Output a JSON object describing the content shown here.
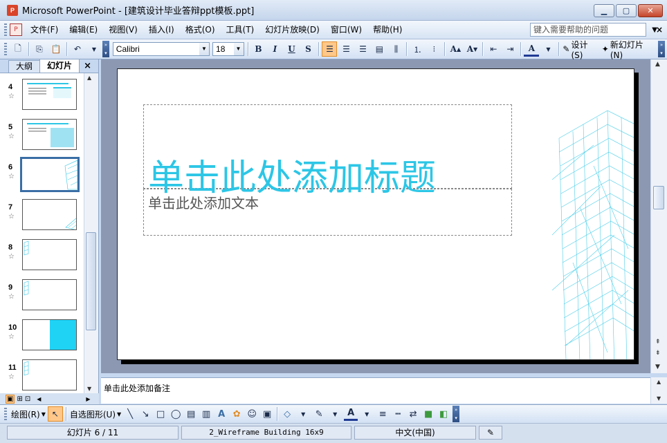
{
  "window": {
    "title": "Microsoft PowerPoint - [建筑设计毕业答辩ppt模板.ppt]"
  },
  "menu": {
    "items": [
      "文件(F)",
      "编辑(E)",
      "视图(V)",
      "插入(I)",
      "格式(O)",
      "工具(T)",
      "幻灯片放映(D)",
      "窗口(W)",
      "帮助(H)"
    ],
    "help_placeholder": "键入需要帮助的问题"
  },
  "toolbar": {
    "font_name": "Calibri",
    "font_size": "18",
    "bold": "B",
    "italic": "I",
    "underline": "U",
    "shadow": "S",
    "design_label": "设计(S)",
    "new_slide_label": "新幻灯片(N)"
  },
  "left_panel": {
    "tabs": [
      "大纲",
      "幻灯片"
    ],
    "thumbnails": [
      {
        "num": "4"
      },
      {
        "num": "5"
      },
      {
        "num": "6",
        "selected": true
      },
      {
        "num": "7"
      },
      {
        "num": "8"
      },
      {
        "num": "9"
      },
      {
        "num": "10"
      },
      {
        "num": "11"
      }
    ]
  },
  "slide": {
    "title": "单击此处添加标题",
    "subtitle": "单击此处添加文本",
    "accent_color": "#2cc6e6"
  },
  "notes": {
    "placeholder": "单击此处添加备注"
  },
  "draw_toolbar": {
    "draw_label": "绘图(R)",
    "autoshapes_label": "自选图形(U)"
  },
  "status": {
    "slide_counter": "幻灯片 6 / 11",
    "design_name": "2_Wireframe Building 16x9",
    "language": "中文(中国)"
  }
}
